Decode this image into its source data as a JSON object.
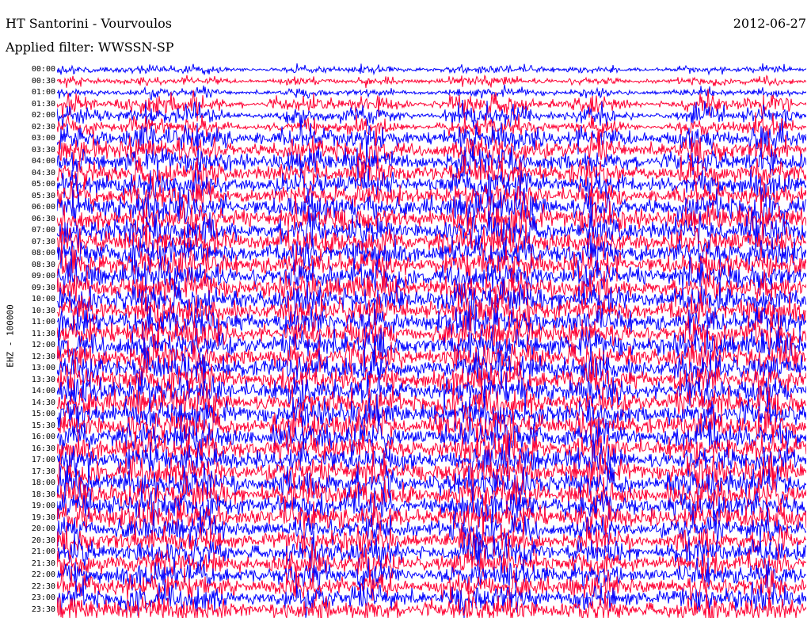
{
  "chart_data": {
    "type": "line",
    "title": "HT Santorini - Vourvoulos",
    "subtitle": "Applied filter: WWSSN-SP",
    "date": "2012-06-27",
    "ylabel": "EHZ - 100000",
    "row_labels": [
      "00:00",
      "00:30",
      "01:00",
      "01:30",
      "02:00",
      "02:30",
      "03:00",
      "03:30",
      "04:00",
      "04:30",
      "05:00",
      "05:30",
      "06:00",
      "06:30",
      "07:00",
      "07:30",
      "08:00",
      "08:30",
      "09:00",
      "09:30",
      "10:00",
      "10:30",
      "11:00",
      "11:30",
      "12:00",
      "12:30",
      "13:00",
      "13:30",
      "14:00",
      "14:30",
      "15:00",
      "15:30",
      "16:00",
      "16:30",
      "17:00",
      "17:30",
      "18:00",
      "18:30",
      "19:00",
      "19:30",
      "20:00",
      "20:30",
      "21:00",
      "21:30",
      "22:00",
      "22:30",
      "23:00",
      "23:30"
    ],
    "series_colors": [
      "#0000ff",
      "#ff0033"
    ],
    "grid": false
  }
}
